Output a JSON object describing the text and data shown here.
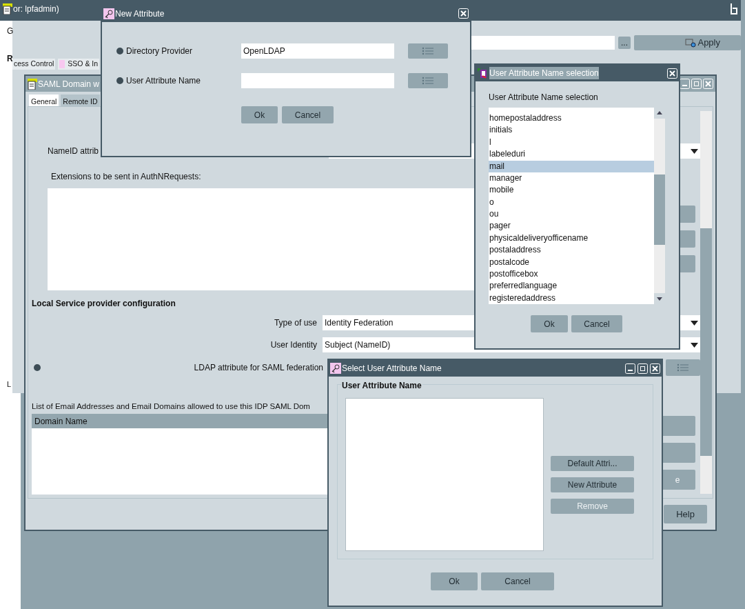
{
  "main_window": {
    "title": "or: lpfadmin)",
    "menu_letter": "G",
    "section_letter": "R",
    "field_button": "...",
    "apply_button": "Apply",
    "bottom_letter": "L",
    "tabs": [
      {
        "label": "cess Control",
        "selected": false
      },
      {
        "label": "SSO & In",
        "selected": false
      }
    ]
  },
  "saml_window": {
    "title": "SAML Domain w",
    "tabs": [
      {
        "label": "General",
        "selected": true
      },
      {
        "label": "Remote ID",
        "selected": false
      }
    ],
    "nameid_label": "NameID attrib",
    "extensions_label": "Extensions to be sent in AuthNRequests:",
    "section_title": "Local Service provider configuration",
    "fields": [
      {
        "label": "Type of use",
        "value": "Identity Federation"
      },
      {
        "label": "User Identity",
        "value": "Subject (NameID)"
      }
    ],
    "ldap_label": "LDAP attribute for SAML federation",
    "ldap_required": true,
    "email_label": "List of Email Addresses and Email Domains allowed to use this IDP SAML Dom",
    "table": {
      "columns": [
        "Domain Name"
      ]
    },
    "side_button_text": "e",
    "help_button": "Help"
  },
  "new_attribute_dialog": {
    "title": "New Attribute",
    "fields": [
      {
        "label": "Directory Provider",
        "value": "OpenLDAP",
        "required": true
      },
      {
        "label": "User Attribute Name",
        "required": true
      }
    ],
    "buttons": [
      "Ok",
      "Cancel"
    ]
  },
  "selection_dialog": {
    "title": "User Attribute Name selection",
    "heading": "User Attribute Name selection",
    "items": [
      {
        "label": "homepostaladdress",
        "selected": false
      },
      {
        "label": "initials",
        "selected": false
      },
      {
        "label": "l",
        "selected": false
      },
      {
        "label": "labeleduri",
        "selected": false
      },
      {
        "label": "mail",
        "selected": true
      },
      {
        "label": "manager",
        "selected": false
      },
      {
        "label": "mobile",
        "selected": false
      },
      {
        "label": "o",
        "selected": false
      },
      {
        "label": "ou",
        "selected": false
      },
      {
        "label": "pager",
        "selected": false
      },
      {
        "label": "physicaldeliveryofficename",
        "selected": false
      },
      {
        "label": "postaladdress",
        "selected": false
      },
      {
        "label": "postalcode",
        "selected": false
      },
      {
        "label": "postofficebox",
        "selected": false
      },
      {
        "label": "preferredlanguage",
        "selected": false
      },
      {
        "label": "registeredaddress",
        "selected": false
      }
    ],
    "buttons": [
      "Ok",
      "Cancel"
    ]
  },
  "select_dialog": {
    "title": "Select User Attribute Name",
    "group_title": "User Attribute Name",
    "buttons": [
      {
        "label": "Default Attri...",
        "disabled": false
      },
      {
        "label": "New Attribute",
        "disabled": false
      },
      {
        "label": "Remove",
        "disabled": true
      }
    ],
    "footer_buttons": [
      "Ok",
      "Cancel"
    ]
  }
}
